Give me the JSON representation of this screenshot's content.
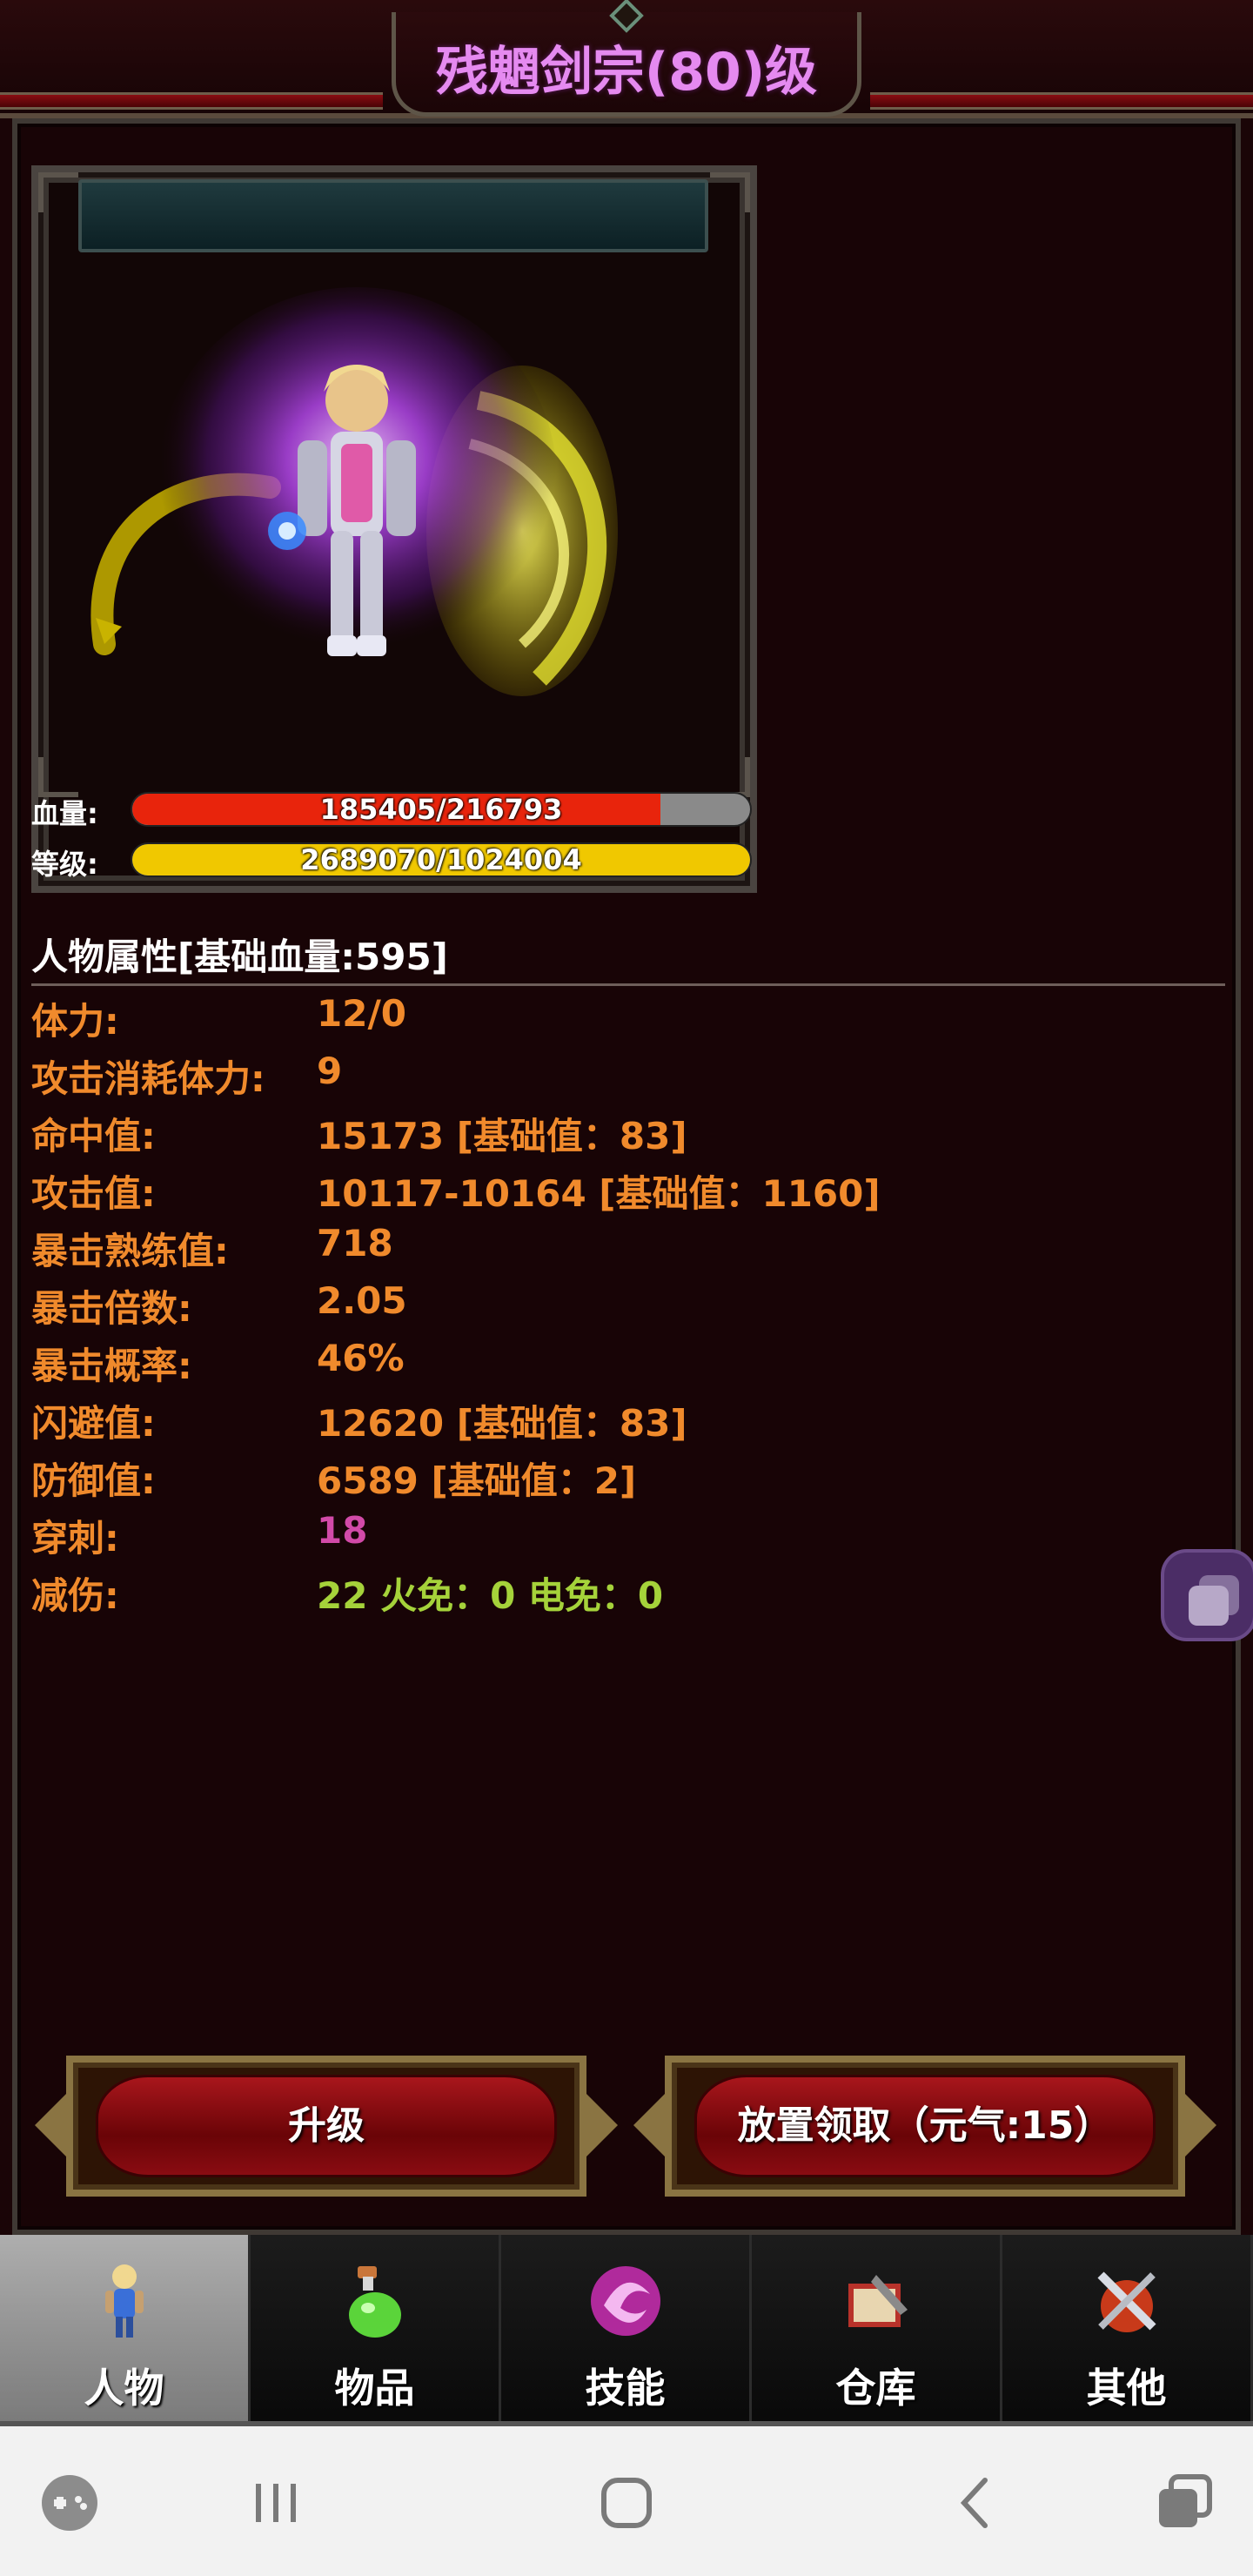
{
  "header": {
    "title": "残魍剑宗(80)级"
  },
  "character": {
    "hp_label": "血量:",
    "hp_text": "185405/216793",
    "hp_fraction": 0.855,
    "level_label": "等级:",
    "level_text": "2689070/1024004",
    "level_fraction": 1.0
  },
  "attributes": {
    "heading": "人物属性[基础血量:595]",
    "rows": [
      {
        "label": "体力:",
        "value": "12/0"
      },
      {
        "label": "攻击消耗体力:",
        "value": "9"
      },
      {
        "label": "命中值:",
        "value": "15173 [基础值：83]"
      },
      {
        "label": "攻击值:",
        "value": "10117-10164 [基础值：1160]"
      },
      {
        "label": "暴击熟练值:",
        "value": "718"
      },
      {
        "label": "暴击倍数:",
        "value": "2.05"
      },
      {
        "label": "暴击概率:",
        "value": "46%"
      },
      {
        "label": "闪避值:",
        "value": "12620 [基础值：83]"
      },
      {
        "label": "防御值:",
        "value": "6589 [基础值：2]"
      },
      {
        "label": "穿刺:",
        "value": "18"
      },
      {
        "label": "减伤:",
        "value": "22 火免：0 电免：0"
      }
    ]
  },
  "actions": {
    "upgrade_label": "升级",
    "idle_claim_label": "放置领取（元气:15）"
  },
  "bottom_nav": {
    "tabs": [
      {
        "label": "人物",
        "icon": "character-icon",
        "active": true
      },
      {
        "label": "物品",
        "icon": "potion-icon",
        "active": false
      },
      {
        "label": "技能",
        "icon": "skill-orb-icon",
        "active": false
      },
      {
        "label": "仓库",
        "icon": "warehouse-icon",
        "active": false
      },
      {
        "label": "其他",
        "icon": "crossed-swords-icon",
        "active": false
      }
    ]
  },
  "colors": {
    "title": "#e58af0",
    "attribute_text": "#f08a2c",
    "pierce": "#d24aa8",
    "damage_reduction": "#a5d23a",
    "hp_bar": "#e8240c",
    "level_bar": "#f0c800"
  }
}
